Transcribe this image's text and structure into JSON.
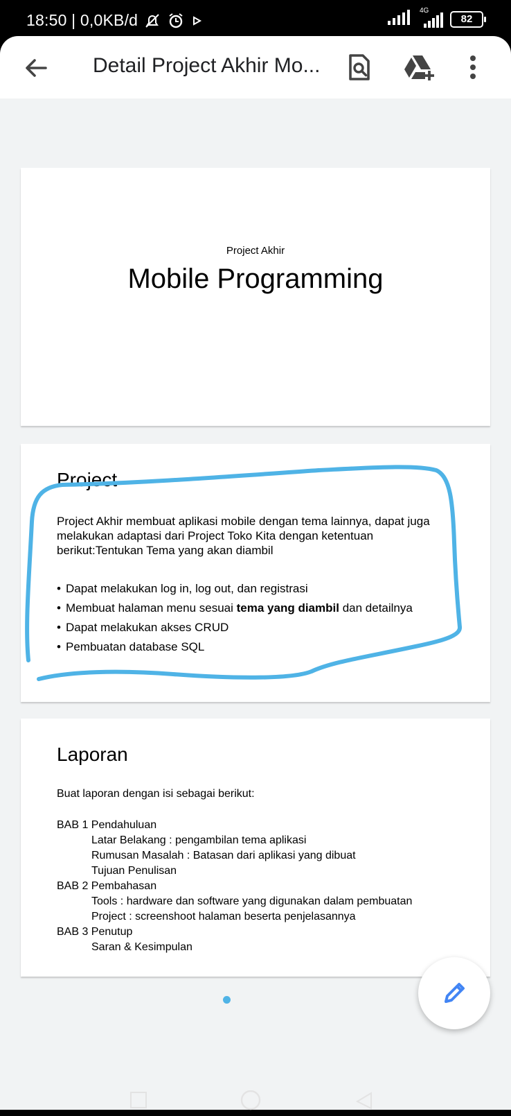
{
  "status_bar": {
    "time_and_speed": "18:50 | 0,0KB/d",
    "network_label": "4G",
    "battery": "82"
  },
  "app_bar": {
    "title": "Detail Project Akhir Mo..."
  },
  "slides": [
    {
      "subtitle": "Project Akhir",
      "title": "Mobile Programming"
    },
    {
      "heading": "Project",
      "paragraph": "Project Akhir membuat aplikasi mobile dengan tema lainnya, dapat juga melakukan adaptasi dari Project Toko Kita dengan ketentuan berikut:Tentukan Tema yang akan diambil",
      "bullets": [
        {
          "text": "Dapat melakukan log in, log out, dan registrasi"
        },
        {
          "before": "Membuat halaman menu sesuai ",
          "bold": "tema yang diambil",
          "after": " dan detailnya"
        },
        {
          "text": "Dapat melakukan akses CRUD"
        },
        {
          "text": "Pembuatan database SQL"
        }
      ]
    },
    {
      "heading": "Laporan",
      "intro": "Buat laporan dengan isi sebagai berikut:",
      "lines": [
        "BAB 1 Pendahuluan",
        "Latar Belakang : pengambilan tema aplikasi",
        "Rumusan Masalah : Batasan dari aplikasi yang dibuat",
        "Tujuan Penulisan",
        "BAB 2 Pembahasan",
        "Tools : hardware dan software yang digunakan dalam pembuatan",
        "Project : screenshoot halaman beserta penjelasannya",
        "BAB 3 Penutup",
        "Saran & Kesimpulan"
      ]
    }
  ],
  "icons": {
    "back": "arrow-back-icon",
    "find_in_doc": "find-in-page-icon",
    "add_to_drive": "add-to-drive-icon",
    "more": "more-vert-icon",
    "edit": "pencil-icon"
  },
  "colors": {
    "annotation_stroke": "#4fb3e6",
    "fab_icon": "#4285f4",
    "page_dot": "#4fb3e6"
  }
}
